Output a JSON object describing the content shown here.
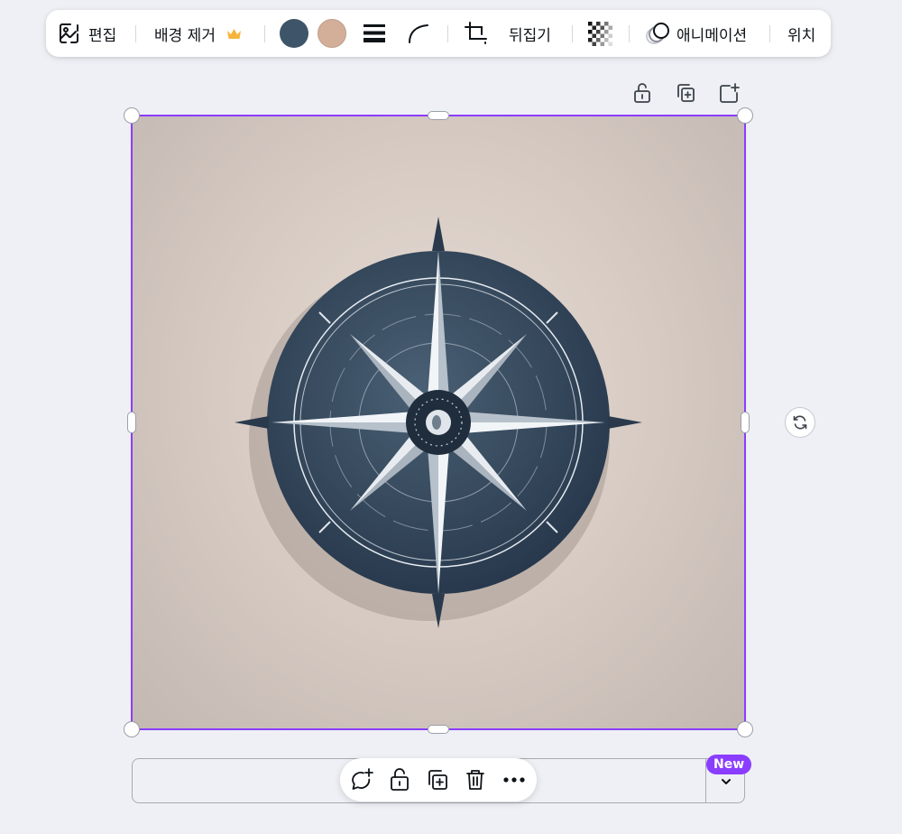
{
  "toolbar": {
    "edit_label": "편집",
    "bg_remove_label": "배경 제거",
    "flip_label": "뒤집기",
    "animate_label": "애니메이션",
    "position_label": "위치",
    "color_1": "#3e5468",
    "color_2": "#d3ae98"
  },
  "canvas": {
    "selection_color": "#8b3dff",
    "image_subject": "compass-rose"
  },
  "caption_box": {
    "new_badge": "New"
  },
  "icons": {
    "edit": "image-edit-icon",
    "premium": "crown-icon",
    "border_style": "line-weight-icon",
    "corner_rounding": "corner-curve-icon",
    "crop": "crop-icon",
    "transparency": "checkerboard-icon",
    "animate": "animation-circles-icon",
    "lock": "lock-icon",
    "duplicate": "duplicate-icon",
    "add_page": "add-page-icon",
    "rotate": "rotate-icon",
    "comment": "comment-add-icon",
    "delete": "trash-icon",
    "more": "more-icon",
    "expand": "chevron-down-icon"
  }
}
